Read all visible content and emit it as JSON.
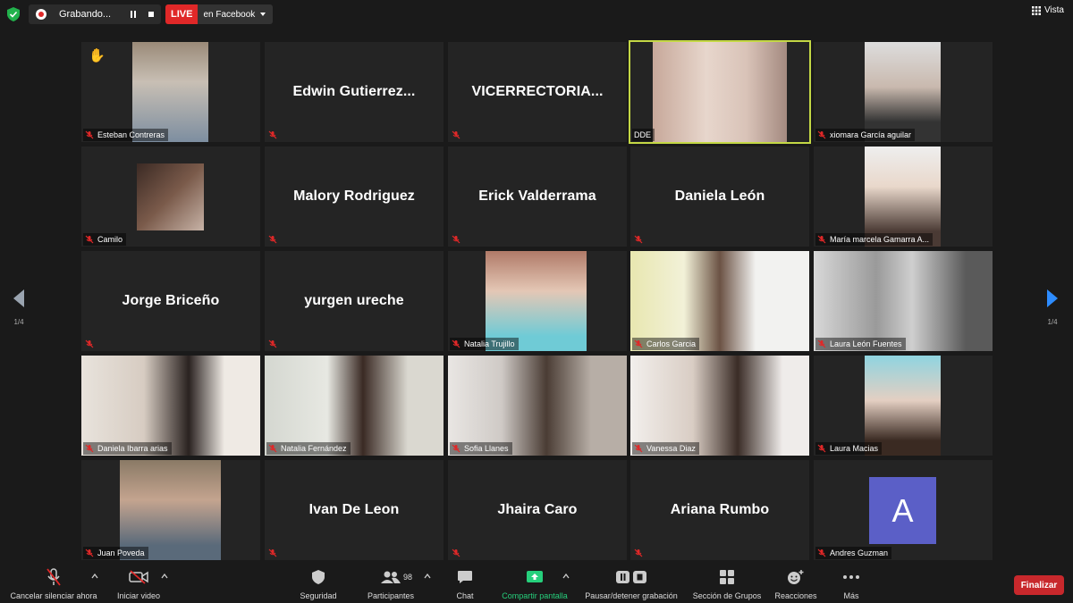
{
  "topbar": {
    "recording_label": "Grabando...",
    "live_label": "LIVE",
    "live_target": "en Facebook",
    "view_label": "Vista"
  },
  "page_indicator": {
    "left": "1/4",
    "right": "1/4"
  },
  "tiles": [
    {
      "name": "Esteban Contreras",
      "big": "",
      "hand": "✋"
    },
    {
      "name": "",
      "big": "Edwin  Gutierrez..."
    },
    {
      "name": "",
      "big": "VICERRECTORIA..."
    },
    {
      "name": "DDE",
      "big": ""
    },
    {
      "name": "xiomara García aguilar",
      "big": ""
    },
    {
      "name": "Camilo",
      "big": ""
    },
    {
      "name": "",
      "big": "Malory Rodriguez"
    },
    {
      "name": "",
      "big": "Erick Valderrama"
    },
    {
      "name": "",
      "big": "Daniela León"
    },
    {
      "name": "María marcela Gamarra A...",
      "big": ""
    },
    {
      "name": "",
      "big": "Jorge Briceño"
    },
    {
      "name": "",
      "big": "yurgen ureche"
    },
    {
      "name": "Natalia Trujillo",
      "big": ""
    },
    {
      "name": "Carlos Garcia",
      "big": ""
    },
    {
      "name": "Laura León Fuentes",
      "big": ""
    },
    {
      "name": "Daniela Ibarra arias",
      "big": ""
    },
    {
      "name": "Natalia Fernández",
      "big": ""
    },
    {
      "name": "Sofia Llanes",
      "big": ""
    },
    {
      "name": "Vanessa Diaz",
      "big": ""
    },
    {
      "name": "Laura Macias",
      "big": ""
    },
    {
      "name": "Juan Poveda",
      "big": ""
    },
    {
      "name": "",
      "big": "Ivan De Leon"
    },
    {
      "name": "",
      "big": "Jhaira Caro"
    },
    {
      "name": "",
      "big": "Ariana Rumbo"
    },
    {
      "name": "Andres Guzman",
      "big": "",
      "avatar_letter": "A"
    }
  ],
  "toolbar": {
    "mute": "Cancelar silenciar ahora",
    "video": "Iniciar video",
    "security": "Seguridad",
    "participants": "Participantes",
    "participants_count": "98",
    "chat": "Chat",
    "share": "Compartir pantalla",
    "pause_rec": "Pausar/detener grabación",
    "breakout": "Sección de Grupos",
    "reactions": "Reacciones",
    "more": "Más",
    "end": "Finalizar"
  },
  "colors": {
    "accent_green": "#26d07c",
    "active_speaker": "#c4d845",
    "live_red": "#e02828",
    "end_red": "#c8282c",
    "avatar_blue": "#5b5fc7"
  }
}
